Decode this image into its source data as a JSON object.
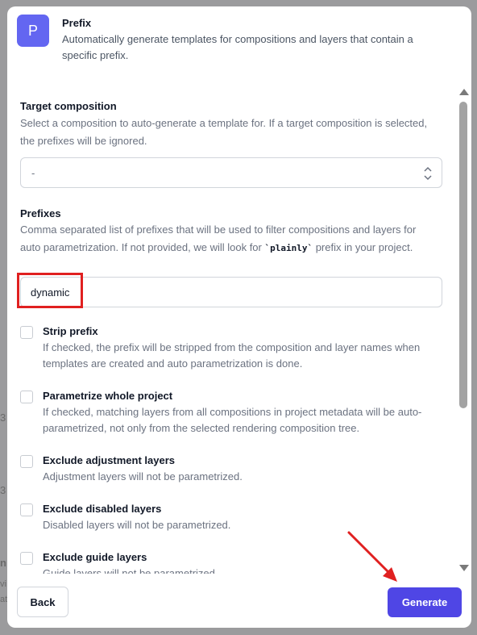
{
  "background": {
    "left_fragments": [
      "3",
      "3",
      "n",
      "vi",
      "at"
    ]
  },
  "header": {
    "avatar_letter": "P",
    "title": "Prefix",
    "description": "Automatically generate templates for compositions and layers that contain a specific prefix."
  },
  "target_composition": {
    "label": "Target composition",
    "help": "Select a composition to auto-generate a template for. If a target composition is selected, the prefixes will be ignored.",
    "selected": "-"
  },
  "prefixes": {
    "label": "Prefixes",
    "help_before": "Comma separated list of prefixes that will be used to filter compositions and layers for auto parametrization. If not provided, we will look for ",
    "help_code": "`plainly`",
    "help_after": " prefix in your project.",
    "value": "dynamic"
  },
  "options": [
    {
      "label": "Strip prefix",
      "help": "If checked, the prefix will be stripped from the composition and layer names when templates are created and auto parametrization is done."
    },
    {
      "label": "Parametrize whole project",
      "help": "If checked, matching layers from all compositions in project metadata will be auto-parametrized, not only from the selected rendering composition tree."
    },
    {
      "label": "Exclude adjustment layers",
      "help": "Adjustment layers will not be parametrized."
    },
    {
      "label": "Exclude disabled layers",
      "help": "Disabled layers will not be parametrized."
    },
    {
      "label": "Exclude guide layers",
      "help": "Guide layers will not be parametrized."
    }
  ],
  "footer": {
    "back_label": "Back",
    "generate_label": "Generate"
  },
  "colors": {
    "accent": "#4f46e5",
    "avatar": "#6366f1",
    "annotation": "#e02020"
  }
}
